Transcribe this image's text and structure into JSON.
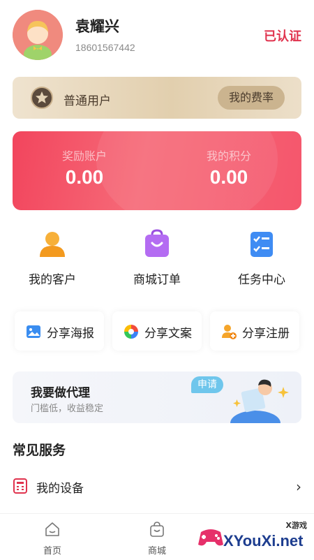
{
  "profile": {
    "name": "袁耀兴",
    "phone": "18601567442",
    "verified_label": "已认证"
  },
  "level": {
    "name": "普通用户",
    "rate_button": "我的费率"
  },
  "accounts": [
    {
      "label": "奖励账户",
      "value": "0.00"
    },
    {
      "label": "我的积分",
      "value": "0.00"
    }
  ],
  "quick_actions": [
    {
      "label": "我的客户",
      "icon": "person-icon"
    },
    {
      "label": "商城订单",
      "icon": "shopping-bag-icon"
    },
    {
      "label": "任务中心",
      "icon": "checklist-icon"
    }
  ],
  "share_buttons": [
    {
      "label": "分享海报",
      "icon": "image-icon"
    },
    {
      "label": "分享文案",
      "icon": "aperture-icon"
    },
    {
      "label": "分享注册",
      "icon": "add-user-icon"
    }
  ],
  "agent_banner": {
    "title": "我要做代理",
    "subtitle": "门槛低，收益稳定",
    "bubble": "申请"
  },
  "services": {
    "title": "常见服务",
    "items": [
      {
        "label": "我的设备",
        "icon": "calculator-icon"
      }
    ]
  },
  "tabbar": {
    "items": [
      {
        "label": "首页",
        "icon": "home-icon"
      },
      {
        "label": "商城",
        "icon": "bag-icon"
      }
    ]
  },
  "watermark": {
    "top": "X游戏",
    "text": "XYouXi.net"
  },
  "colors": {
    "accent_red": "#e0334e",
    "card_red": "#f2455d",
    "gold": "#cbb48f"
  }
}
